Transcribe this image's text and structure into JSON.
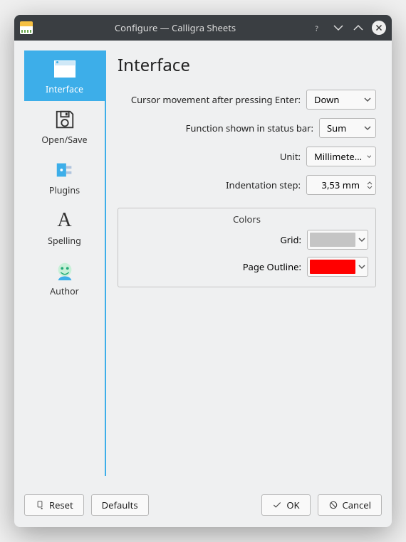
{
  "window": {
    "title": "Configure — Calligra Sheets"
  },
  "sidebar": {
    "items": [
      {
        "label": "Interface"
      },
      {
        "label": "Open/Save"
      },
      {
        "label": "Plugins"
      },
      {
        "label": "Spelling"
      },
      {
        "label": "Author"
      }
    ]
  },
  "main": {
    "heading": "Interface",
    "cursor_label": "Cursor movement after pressing Enter:",
    "cursor_value": "Down",
    "function_label": "Function shown in status bar:",
    "function_value": "Sum",
    "unit_label": "Unit:",
    "unit_value": "Millimeters (mm)",
    "indent_label": "Indentation step:",
    "indent_value": "3,53 mm",
    "colors_group": "Colors",
    "grid_label": "Grid:",
    "grid_color": "#c5c5c5",
    "outline_label": "Page Outline:",
    "outline_color": "#ff0000"
  },
  "footer": {
    "reset": "Reset",
    "defaults": "Defaults",
    "ok": "OK",
    "cancel": "Cancel"
  }
}
